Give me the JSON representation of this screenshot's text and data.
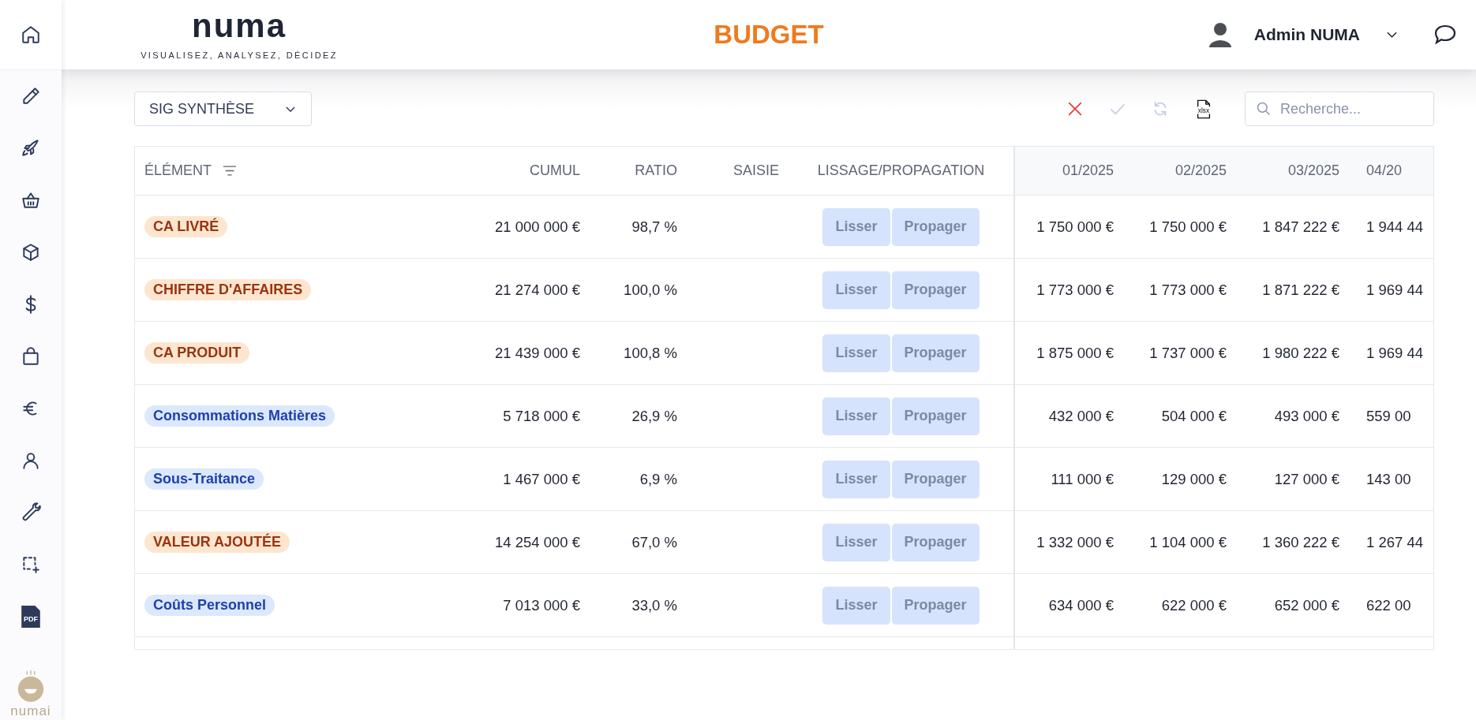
{
  "sidebar": {
    "items": [
      {
        "kind": "home"
      },
      {
        "kind": "pencil"
      },
      {
        "kind": "rocket"
      },
      {
        "kind": "basket"
      },
      {
        "kind": "box"
      },
      {
        "kind": "dollar"
      },
      {
        "kind": "bag"
      },
      {
        "kind": "euro"
      },
      {
        "kind": "user"
      },
      {
        "kind": "wrench"
      },
      {
        "kind": "select-add"
      },
      {
        "kind": "pdf",
        "label": "PDF"
      }
    ],
    "assistant": {
      "name": "numai"
    }
  },
  "header": {
    "logo": "numa",
    "tagline": "VISUALISEZ, ANALYSEZ, DÉCIDEZ",
    "title": "BUDGET",
    "user": "Admin NUMA"
  },
  "toolbar": {
    "view_select": "SIG SYNTHÈSE",
    "actions": [
      {
        "kind": "cancel",
        "disabled": false
      },
      {
        "kind": "validate",
        "disabled": true
      },
      {
        "kind": "refresh",
        "disabled": true
      },
      {
        "kind": "export",
        "label": "xlsx",
        "disabled": false
      }
    ],
    "search": {
      "placeholder": "Recherche..."
    }
  },
  "table": {
    "columns": [
      "ÉLÉMENT",
      "CUMUL",
      "RATIO",
      "SAISIE",
      "LISSAGE/PROPAGATION",
      "01/2025",
      "02/2025",
      "03/2025",
      "04/20"
    ],
    "rows": [
      {
        "element": "CA LIVRÉ",
        "kind": "total",
        "cumul": "21 000 000 €",
        "ratio": "98,7 %",
        "actions": [
          {
            "label": "Lisser",
            "disabled": true
          },
          {
            "label": "Propager",
            "disabled": true
          }
        ],
        "months": [
          "1 750 000 €",
          "1 750 000 €",
          "1 847 222 €",
          "1 944 44"
        ]
      },
      {
        "element": "CHIFFRE D'AFFAIRES",
        "kind": "total",
        "cumul": "21 274 000 €",
        "ratio": "100,0 %",
        "actions": [
          {
            "label": "Lisser",
            "disabled": true
          },
          {
            "label": "Propager",
            "disabled": true
          }
        ],
        "months": [
          "1 773 000 €",
          "1 773 000 €",
          "1 871 222 €",
          "1 969 44"
        ]
      },
      {
        "element": "CA PRODUIT",
        "kind": "total",
        "cumul": "21 439 000 €",
        "ratio": "100,8 %",
        "actions": [
          {
            "label": "Lisser",
            "disabled": true
          },
          {
            "label": "Propager",
            "disabled": true
          }
        ],
        "months": [
          "1 875 000 €",
          "1 737 000 €",
          "1 980 222 €",
          "1 969 44"
        ]
      },
      {
        "element": "Consommations Matières",
        "kind": "detail",
        "cumul": "5 718 000 €",
        "ratio": "26,9 %",
        "actions": [
          {
            "label": "Lisser",
            "disabled": true
          },
          {
            "label": "Propager",
            "disabled": true
          }
        ],
        "months": [
          "432 000 €",
          "504 000 €",
          "493 000 €",
          "559 00"
        ]
      },
      {
        "element": "Sous-Traitance",
        "kind": "detail",
        "cumul": "1 467 000 €",
        "ratio": "6,9 %",
        "actions": [
          {
            "label": "Lisser",
            "disabled": true
          },
          {
            "label": "Propager",
            "disabled": true
          }
        ],
        "months": [
          "111 000 €",
          "129 000 €",
          "127 000 €",
          "143 00"
        ]
      },
      {
        "element": "VALEUR AJOUTÉE",
        "kind": "total",
        "cumul": "14 254 000 €",
        "ratio": "67,0 %",
        "actions": [
          {
            "label": "Lisser",
            "disabled": true
          },
          {
            "label": "Propager",
            "disabled": true
          }
        ],
        "months": [
          "1 332 000 €",
          "1 104 000 €",
          "1 360 222 €",
          "1 267 44"
        ]
      },
      {
        "element": "Coûts Personnel",
        "kind": "detail",
        "cumul": "7 013 000 €",
        "ratio": "33,0 %",
        "actions": [
          {
            "label": "Lisser",
            "disabled": true
          },
          {
            "label": "Propager",
            "disabled": true
          }
        ],
        "months": [
          "634 000 €",
          "622 000 €",
          "652 000 €",
          "622 00"
        ]
      }
    ]
  }
}
